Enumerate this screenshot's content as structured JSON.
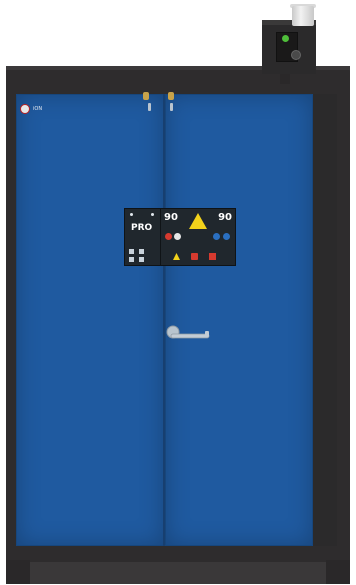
{
  "brand": {
    "text": "iON"
  },
  "labels": {
    "pro": "PRO",
    "fire_rating_left": "90",
    "fire_rating_right": "90"
  },
  "colors": {
    "door_blue": "#1f5aa0",
    "body_anthracite": "#2e2c2d",
    "status_led": "#4fbe3a",
    "warning_yellow": "#f2d21b"
  },
  "icons": [
    "flammable-warning-icon",
    "no-fire-icon",
    "safety-info-icon",
    "door-handle-icon",
    "lock-icon",
    "vent-status-led-icon"
  ]
}
